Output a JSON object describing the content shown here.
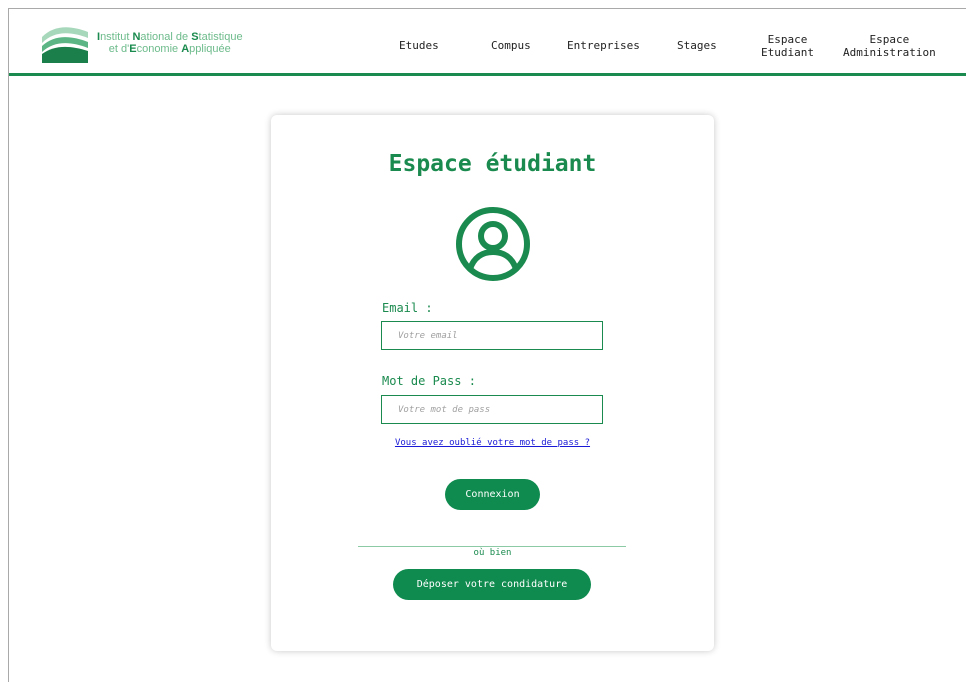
{
  "brand": {
    "line1": [
      {
        "t": "I",
        "b": true
      },
      {
        "t": "nstitut ",
        "b": false
      },
      {
        "t": "N",
        "b": true
      },
      {
        "t": "ational de ",
        "b": false
      },
      {
        "t": "S",
        "b": true
      },
      {
        "t": "tatistique",
        "b": false
      }
    ],
    "line2": [
      {
        "t": "et d'",
        "b": false
      },
      {
        "t": "E",
        "b": true
      },
      {
        "t": "conomie ",
        "b": false
      },
      {
        "t": "A",
        "b": true
      },
      {
        "t": "ppliquée",
        "b": false
      }
    ]
  },
  "nav": {
    "etudes": "Etudes",
    "compus": "Compus",
    "entreprises": "Entreprises",
    "stages": "Stages",
    "espace_etudiant_l1": "Espace",
    "espace_etudiant_l2": "Etudiant",
    "espace_admin_l1": "Espace",
    "espace_admin_l2": "Administration"
  },
  "login": {
    "title": "Espace étudiant",
    "email_label": "Email :",
    "email_placeholder": "Votre email",
    "email_value": "",
    "password_label": "Mot de Pass :",
    "password_placeholder": "Votre mot de pass",
    "password_value": "",
    "forgot_link": "Vous avez oublié votre mot de pass ?",
    "connexion_button": "Connexion",
    "divider_text": "où bien",
    "apply_button": "Déposer votre condidature"
  },
  "colors": {
    "primary": "#1a8a4e",
    "button": "#0f8b4f",
    "link": "#1a1ad6",
    "logo_light": "#6dbb8b"
  },
  "icons": {
    "logo": "inseaa-wave-logo",
    "user": "user-circle-icon"
  }
}
